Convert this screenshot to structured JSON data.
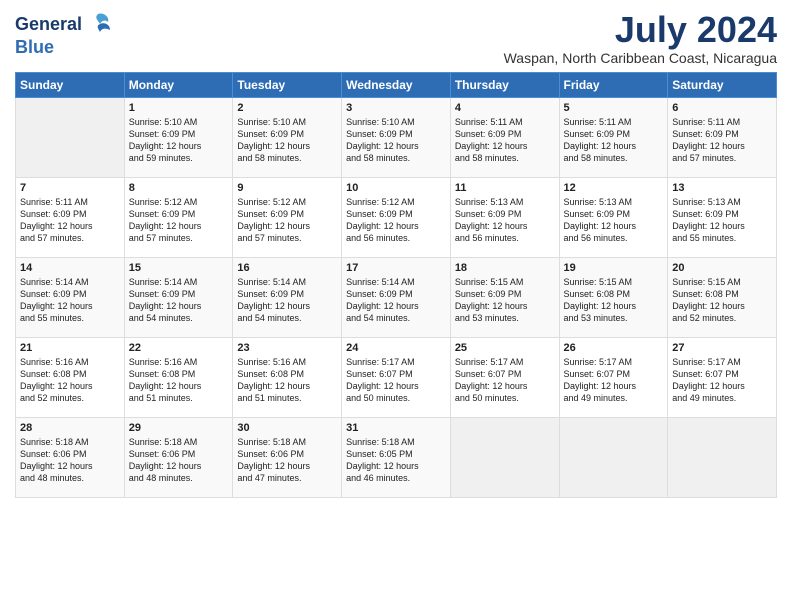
{
  "logo": {
    "line1": "General",
    "line2": "Blue"
  },
  "title": "July 2024",
  "location": "Waspan, North Caribbean Coast, Nicaragua",
  "days_of_week": [
    "Sunday",
    "Monday",
    "Tuesday",
    "Wednesday",
    "Thursday",
    "Friday",
    "Saturday"
  ],
  "weeks": [
    [
      {
        "day": "",
        "empty": true
      },
      {
        "day": "1",
        "sunrise": "5:10 AM",
        "sunset": "6:09 PM",
        "daylight": "12 hours and 59 minutes."
      },
      {
        "day": "2",
        "sunrise": "5:10 AM",
        "sunset": "6:09 PM",
        "daylight": "12 hours and 58 minutes."
      },
      {
        "day": "3",
        "sunrise": "5:10 AM",
        "sunset": "6:09 PM",
        "daylight": "12 hours and 58 minutes."
      },
      {
        "day": "4",
        "sunrise": "5:11 AM",
        "sunset": "6:09 PM",
        "daylight": "12 hours and 58 minutes."
      },
      {
        "day": "5",
        "sunrise": "5:11 AM",
        "sunset": "6:09 PM",
        "daylight": "12 hours and 58 minutes."
      },
      {
        "day": "6",
        "sunrise": "5:11 AM",
        "sunset": "6:09 PM",
        "daylight": "12 hours and 57 minutes."
      }
    ],
    [
      {
        "day": "7",
        "sunrise": "5:11 AM",
        "sunset": "6:09 PM",
        "daylight": "12 hours and 57 minutes."
      },
      {
        "day": "8",
        "sunrise": "5:12 AM",
        "sunset": "6:09 PM",
        "daylight": "12 hours and 57 minutes."
      },
      {
        "day": "9",
        "sunrise": "5:12 AM",
        "sunset": "6:09 PM",
        "daylight": "12 hours and 57 minutes."
      },
      {
        "day": "10",
        "sunrise": "5:12 AM",
        "sunset": "6:09 PM",
        "daylight": "12 hours and 56 minutes."
      },
      {
        "day": "11",
        "sunrise": "5:13 AM",
        "sunset": "6:09 PM",
        "daylight": "12 hours and 56 minutes."
      },
      {
        "day": "12",
        "sunrise": "5:13 AM",
        "sunset": "6:09 PM",
        "daylight": "12 hours and 56 minutes."
      },
      {
        "day": "13",
        "sunrise": "5:13 AM",
        "sunset": "6:09 PM",
        "daylight": "12 hours and 55 minutes."
      }
    ],
    [
      {
        "day": "14",
        "sunrise": "5:14 AM",
        "sunset": "6:09 PM",
        "daylight": "12 hours and 55 minutes."
      },
      {
        "day": "15",
        "sunrise": "5:14 AM",
        "sunset": "6:09 PM",
        "daylight": "12 hours and 54 minutes."
      },
      {
        "day": "16",
        "sunrise": "5:14 AM",
        "sunset": "6:09 PM",
        "daylight": "12 hours and 54 minutes."
      },
      {
        "day": "17",
        "sunrise": "5:14 AM",
        "sunset": "6:09 PM",
        "daylight": "12 hours and 54 minutes."
      },
      {
        "day": "18",
        "sunrise": "5:15 AM",
        "sunset": "6:09 PM",
        "daylight": "12 hours and 53 minutes."
      },
      {
        "day": "19",
        "sunrise": "5:15 AM",
        "sunset": "6:08 PM",
        "daylight": "12 hours and 53 minutes."
      },
      {
        "day": "20",
        "sunrise": "5:15 AM",
        "sunset": "6:08 PM",
        "daylight": "12 hours and 52 minutes."
      }
    ],
    [
      {
        "day": "21",
        "sunrise": "5:16 AM",
        "sunset": "6:08 PM",
        "daylight": "12 hours and 52 minutes."
      },
      {
        "day": "22",
        "sunrise": "5:16 AM",
        "sunset": "6:08 PM",
        "daylight": "12 hours and 51 minutes."
      },
      {
        "day": "23",
        "sunrise": "5:16 AM",
        "sunset": "6:08 PM",
        "daylight": "12 hours and 51 minutes."
      },
      {
        "day": "24",
        "sunrise": "5:17 AM",
        "sunset": "6:07 PM",
        "daylight": "12 hours and 50 minutes."
      },
      {
        "day": "25",
        "sunrise": "5:17 AM",
        "sunset": "6:07 PM",
        "daylight": "12 hours and 50 minutes."
      },
      {
        "day": "26",
        "sunrise": "5:17 AM",
        "sunset": "6:07 PM",
        "daylight": "12 hours and 49 minutes."
      },
      {
        "day": "27",
        "sunrise": "5:17 AM",
        "sunset": "6:07 PM",
        "daylight": "12 hours and 49 minutes."
      }
    ],
    [
      {
        "day": "28",
        "sunrise": "5:18 AM",
        "sunset": "6:06 PM",
        "daylight": "12 hours and 48 minutes."
      },
      {
        "day": "29",
        "sunrise": "5:18 AM",
        "sunset": "6:06 PM",
        "daylight": "12 hours and 48 minutes."
      },
      {
        "day": "30",
        "sunrise": "5:18 AM",
        "sunset": "6:06 PM",
        "daylight": "12 hours and 47 minutes."
      },
      {
        "day": "31",
        "sunrise": "5:18 AM",
        "sunset": "6:05 PM",
        "daylight": "12 hours and 46 minutes."
      },
      {
        "day": "",
        "empty": true
      },
      {
        "day": "",
        "empty": true
      },
      {
        "day": "",
        "empty": true
      }
    ]
  ]
}
